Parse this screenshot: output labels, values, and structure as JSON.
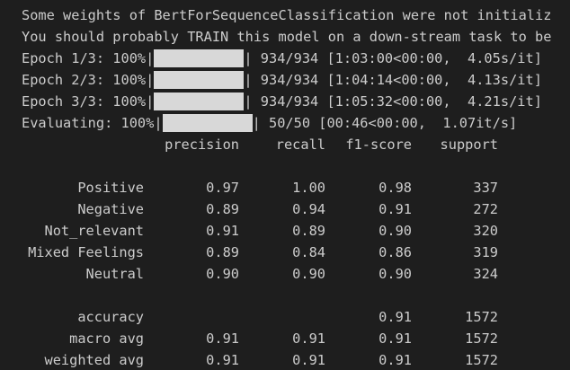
{
  "log": {
    "line1": "Some weights of BertForSequenceClassification were not initializ",
    "line2": "You should probably TRAIN this model on a down-stream task to be",
    "progress": [
      {
        "prefix": "Epoch 1/3: 100%|",
        "suffix": "| 934/934 [1:03:00<00:00,  4.05s/it]",
        "fraction": 1.0
      },
      {
        "prefix": "Epoch 2/3: 100%|",
        "suffix": "| 934/934 [1:04:14<00:00,  4.13s/it]",
        "fraction": 1.0
      },
      {
        "prefix": "Epoch 3/3: 100%|",
        "suffix": "| 934/934 [1:05:32<00:00,  4.21s/it]",
        "fraction": 1.0
      },
      {
        "prefix": "Evaluating: 100%|",
        "suffix": "| 50/50 [00:46<00:00,  1.07it/s]",
        "fraction": 1.0
      }
    ]
  },
  "report": {
    "headers": {
      "precision": "precision",
      "recall": "recall",
      "f1": "f1-score",
      "support": "support"
    },
    "rows": [
      {
        "label": "Positive",
        "precision": "0.97",
        "recall": "1.00",
        "f1": "0.98",
        "support": "337"
      },
      {
        "label": "Negative",
        "precision": "0.89",
        "recall": "0.94",
        "f1": "0.91",
        "support": "272"
      },
      {
        "label": "Not_relevant",
        "precision": "0.91",
        "recall": "0.89",
        "f1": "0.90",
        "support": "320"
      },
      {
        "label": "Mixed Feelings",
        "precision": "0.89",
        "recall": "0.84",
        "f1": "0.86",
        "support": "319"
      },
      {
        "label": "Neutral",
        "precision": "0.90",
        "recall": "0.90",
        "f1": "0.90",
        "support": "324"
      }
    ],
    "summary": [
      {
        "label": "accuracy",
        "precision": "",
        "recall": "",
        "f1": "0.91",
        "support": "1572"
      },
      {
        "label": "macro avg",
        "precision": "0.91",
        "recall": "0.91",
        "f1": "0.91",
        "support": "1572"
      },
      {
        "label": "weighted avg",
        "precision": "0.91",
        "recall": "0.91",
        "f1": "0.91",
        "support": "1572"
      }
    ]
  }
}
